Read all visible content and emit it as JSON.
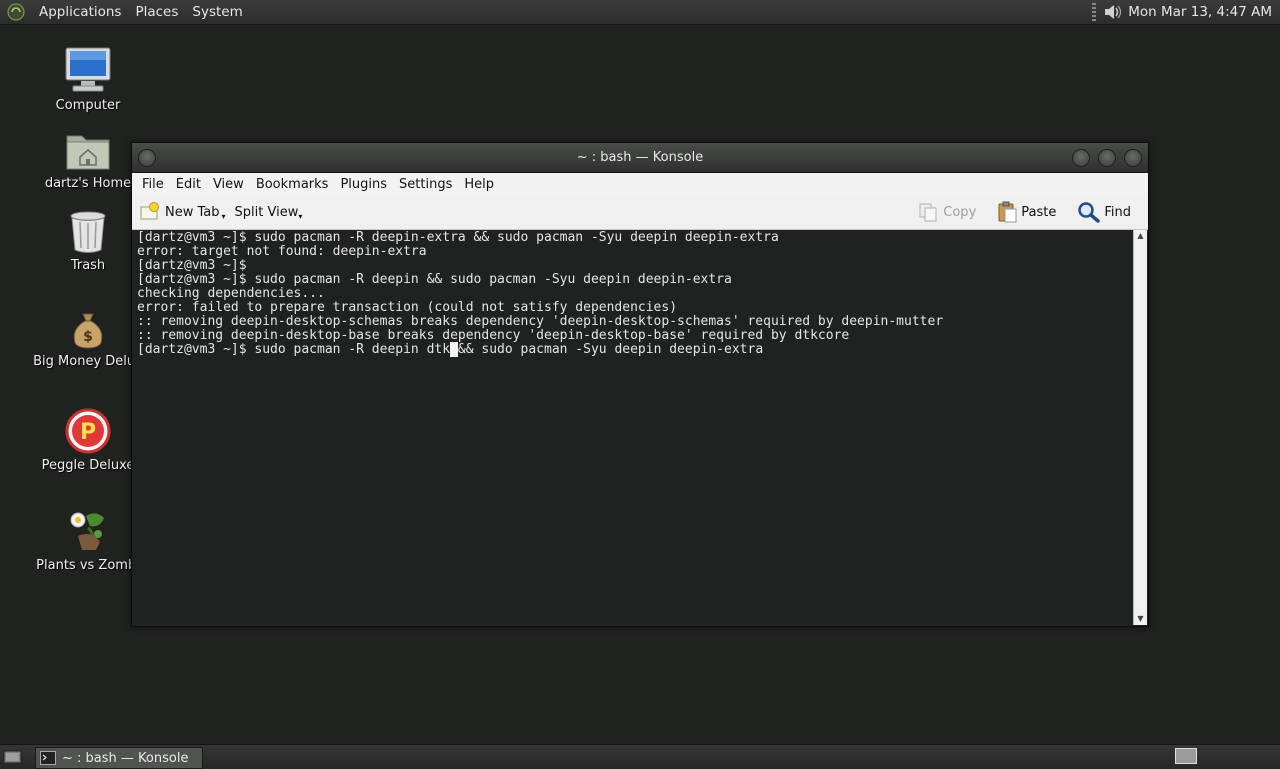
{
  "top_panel": {
    "menus": [
      "Applications",
      "Places",
      "System"
    ],
    "clock": "Mon Mar 13,  4:47 AM",
    "icons": {
      "logo": "gnome-foot-icon",
      "volume": "volume-icon"
    }
  },
  "desktop": {
    "icons": [
      {
        "label": "Computer",
        "icon": "computer-icon"
      },
      {
        "label": "dartz's Home",
        "icon": "home-folder-icon"
      },
      {
        "label": "Trash",
        "icon": "trash-icon"
      },
      {
        "label": "Big Money Delux",
        "icon": "money-bag-icon"
      },
      {
        "label": "Peggle Deluxe",
        "icon": "peggle-icon"
      },
      {
        "label": "Plants vs Zombi",
        "icon": "plants-vs-zombies-icon"
      }
    ]
  },
  "konsole": {
    "title": "~ : bash — Konsole",
    "menu": [
      "File",
      "Edit",
      "View",
      "Bookmarks",
      "Plugins",
      "Settings",
      "Help"
    ],
    "toolbar": {
      "new_tab": "New Tab",
      "split_view": "Split View",
      "copy": "Copy",
      "paste": "Paste",
      "find": "Find"
    },
    "terminal": {
      "lines": [
        "[dartz@vm3 ~]$ sudo pacman -R deepin-extra && sudo pacman -Syu deepin deepin-extra",
        "error: target not found: deepin-extra",
        "[dartz@vm3 ~]$",
        "[dartz@vm3 ~]$ sudo pacman -R deepin && sudo pacman -Syu deepin deepin-extra",
        "checking dependencies...",
        "error: failed to prepare transaction (could not satisfy dependencies)",
        ":: removing deepin-desktop-schemas breaks dependency 'deepin-desktop-schemas' required by deepin-mutter",
        ":: removing deepin-desktop-base breaks dependency 'deepin-desktop-base' required by dtkcore"
      ],
      "prompt_line_before_cursor": "[dartz@vm3 ~]$ sudo pacman -R deepin dtk",
      "cursor_char": " ",
      "prompt_line_after_cursor": "&& sudo pacman -Syu deepin deepin-extra"
    }
  },
  "taskbar": {
    "tasks": [
      {
        "label": "~ : bash — Konsole",
        "icon": "terminal-icon"
      }
    ]
  },
  "colors": {
    "desktop_bg": "#202220",
    "terminal_bg": "#1f2220",
    "terminal_fg": "#e5e5e5"
  }
}
